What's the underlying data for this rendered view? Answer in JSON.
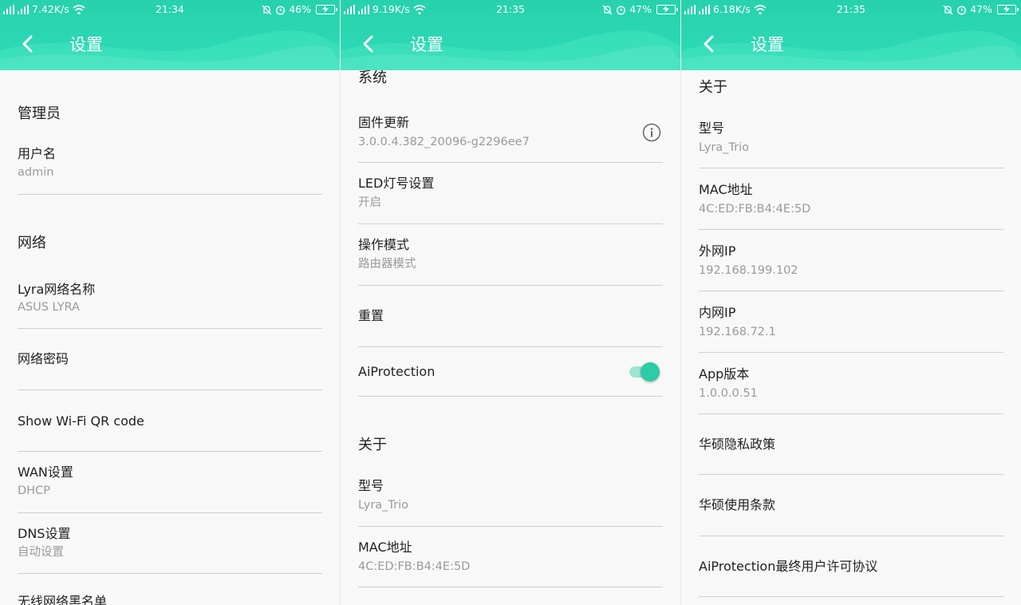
{
  "colors": {
    "header": "#2fdcb7",
    "accent": "#2bcca6"
  },
  "screens": [
    {
      "status": {
        "speed": "7.42K/s",
        "time": "21:34",
        "battery": "46%"
      },
      "title": "设置",
      "sections": {
        "admin": "管理员",
        "network": "网络"
      },
      "items": {
        "username": {
          "label": "用户名",
          "value": "admin"
        },
        "lyra_name": {
          "label": "Lyra网络名称",
          "value": "ASUS LYRA"
        },
        "net_password": {
          "label": "网络密码"
        },
        "qr": {
          "label": "Show Wi-Fi QR code"
        },
        "wan": {
          "label": "WAN设置",
          "value": "DHCP"
        },
        "dns": {
          "label": "DNS设置",
          "value": "自动设置"
        },
        "partial": {
          "label": "无线网络黑名单"
        }
      }
    },
    {
      "status": {
        "speed": "9.19K/s",
        "time": "21:35",
        "battery": "47%"
      },
      "title": "设置",
      "sections": {
        "system": "系统",
        "about": "关于"
      },
      "items": {
        "firmware": {
          "label": "固件更新",
          "value": "3.0.0.4.382_20096-g2296ee7"
        },
        "led": {
          "label": "LED灯号设置",
          "value": "开启"
        },
        "mode": {
          "label": "操作模式",
          "value": "路由器模式"
        },
        "reset": {
          "label": "重置"
        },
        "aiprotection": {
          "label": "AiProtection",
          "enabled": true
        },
        "model": {
          "label": "型号",
          "value": "Lyra_Trio"
        },
        "mac": {
          "label": "MAC地址",
          "value": "4C:ED:FB:B4:4E:5D"
        }
      }
    },
    {
      "status": {
        "speed": "6.18K/s",
        "time": "21:35",
        "battery": "47%"
      },
      "title": "设置",
      "sections": {
        "about": "关于"
      },
      "items": {
        "model": {
          "label": "型号",
          "value": "Lyra_Trio"
        },
        "mac": {
          "label": "MAC地址",
          "value": "4C:ED:FB:B4:4E:5D"
        },
        "wan_ip": {
          "label": "外网IP",
          "value": "192.168.199.102"
        },
        "lan_ip": {
          "label": "内网IP",
          "value": "192.168.72.1"
        },
        "app_version": {
          "label": "App版本",
          "value": "1.0.0.0.51"
        },
        "privacy": {
          "label": "华硕隐私政策"
        },
        "terms": {
          "label": "华硕使用条款"
        },
        "eula": {
          "label": "AiProtection最终用户许可协议"
        }
      }
    }
  ]
}
